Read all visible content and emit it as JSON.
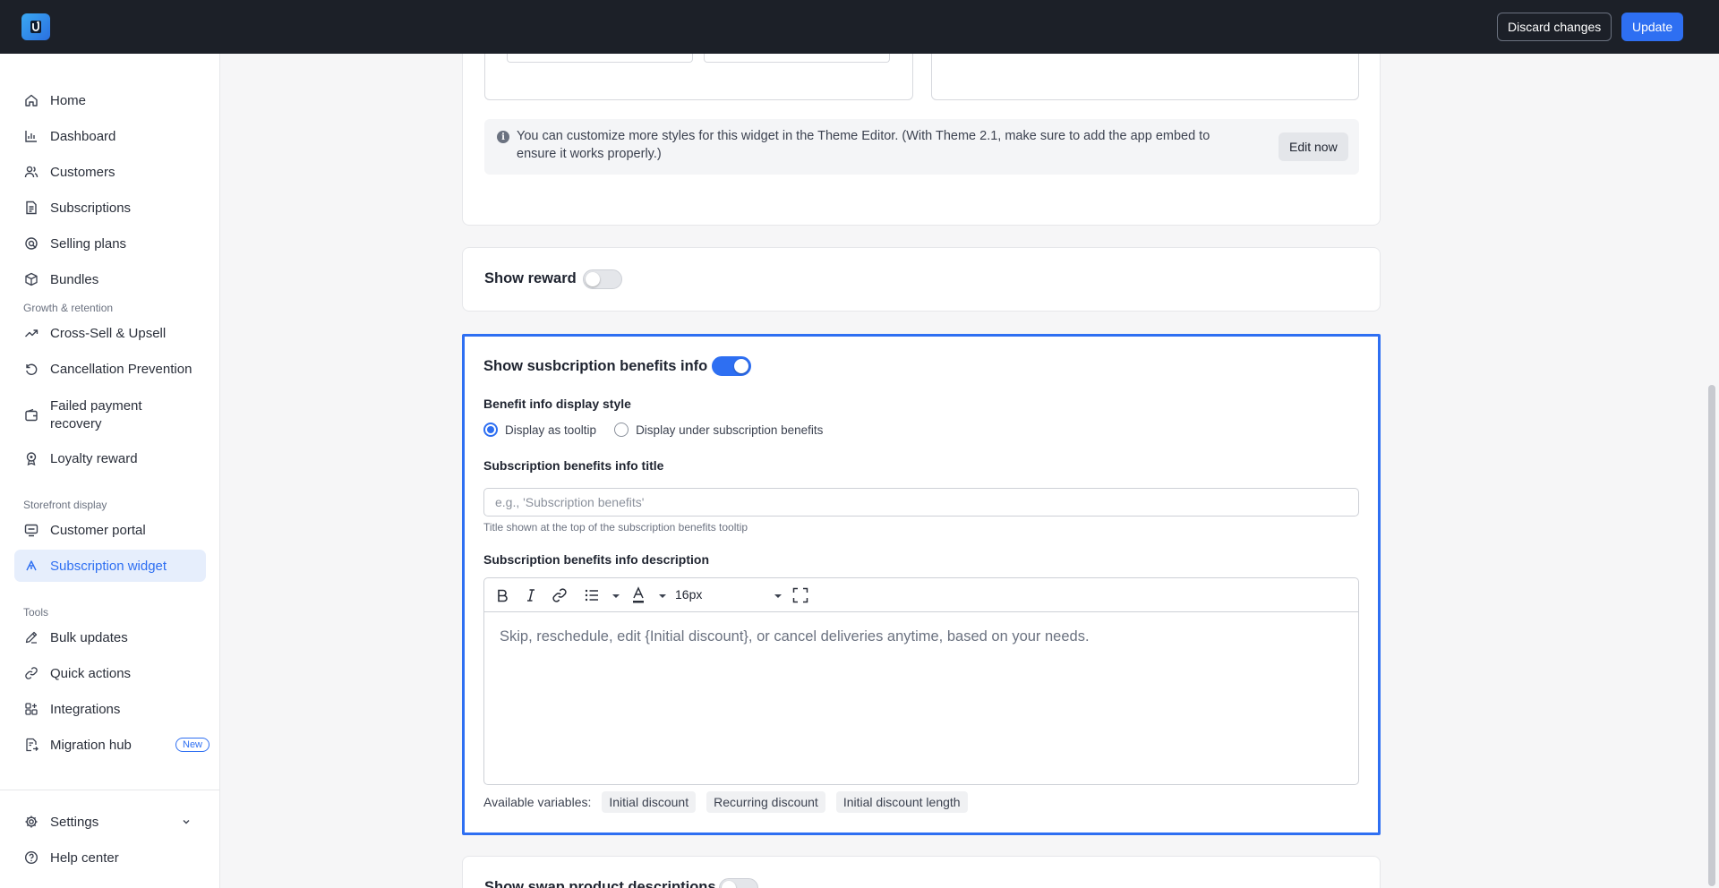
{
  "header": {
    "discard_label": "Discard changes",
    "update_label": "Update"
  },
  "sidebar": {
    "main_items": [
      {
        "label": "Home",
        "icon": "home-icon"
      },
      {
        "label": "Dashboard",
        "icon": "bar-chart-icon"
      },
      {
        "label": "Customers",
        "icon": "users-icon"
      },
      {
        "label": "Subscriptions",
        "icon": "document-icon"
      },
      {
        "label": "Selling plans",
        "icon": "tag-icon"
      },
      {
        "label": "Bundles",
        "icon": "package-icon"
      }
    ],
    "growth_label": "Growth & retention",
    "growth_items": [
      {
        "label": "Cross-Sell & Upsell",
        "icon": "trending-up-icon"
      },
      {
        "label": "Cancellation Prevention",
        "icon": "rotate-icon"
      },
      {
        "label": "Failed payment recovery",
        "icon": "wallet-icon"
      },
      {
        "label": "Loyalty reward",
        "icon": "award-icon"
      }
    ],
    "storefront_label": "Storefront display",
    "storefront_items": [
      {
        "label": "Customer portal",
        "icon": "monitor-icon"
      },
      {
        "label": "Subscription widget",
        "icon": "widget-icon",
        "active": true
      }
    ],
    "tools_label": "Tools",
    "tools_items": [
      {
        "label": "Bulk updates",
        "icon": "pencil-icon"
      },
      {
        "label": "Quick actions",
        "icon": "link-icon"
      },
      {
        "label": "Integrations",
        "icon": "grid-icon"
      },
      {
        "label": "Migration hub",
        "icon": "migrate-icon",
        "badge": "New"
      }
    ],
    "settings_label": "Settings",
    "help_label": "Help center"
  },
  "theme_info": {
    "text": "You can customize more styles for this widget in the Theme Editor. (With Theme 2.1, make sure to add the app embed to ensure it works properly.)",
    "edit_now_label": "Edit now"
  },
  "show_reward": {
    "title": "Show reward",
    "enabled": false
  },
  "benefits": {
    "title": "Show susbcription benefits info",
    "enabled": true,
    "display_style_label": "Benefit info display style",
    "display_options": [
      {
        "label": "Display as tooltip",
        "checked": true
      },
      {
        "label": "Display under subscription benefits",
        "checked": false
      }
    ],
    "info_title_label": "Subscription benefits info title",
    "info_title_value": "",
    "info_title_placeholder": "e.g., 'Subscription benefits'",
    "info_title_help": "Title shown at the top of the subscription benefits tooltip",
    "description_label": "Subscription benefits info description",
    "font_size": "16px",
    "description_text": "Skip, reschedule, edit {Initial discount}, or cancel deliveries anytime, based on your needs.",
    "variables_label": "Available variables:",
    "variables": [
      "Initial discount",
      "Recurring discount",
      "Initial discount length"
    ]
  },
  "show_swap": {
    "title": "Show swap product descriptions",
    "enabled": false
  },
  "colors": {
    "accent": "#2e6ff2",
    "topbar": "#1c2028",
    "active_nav_bg": "#e6eefc"
  }
}
